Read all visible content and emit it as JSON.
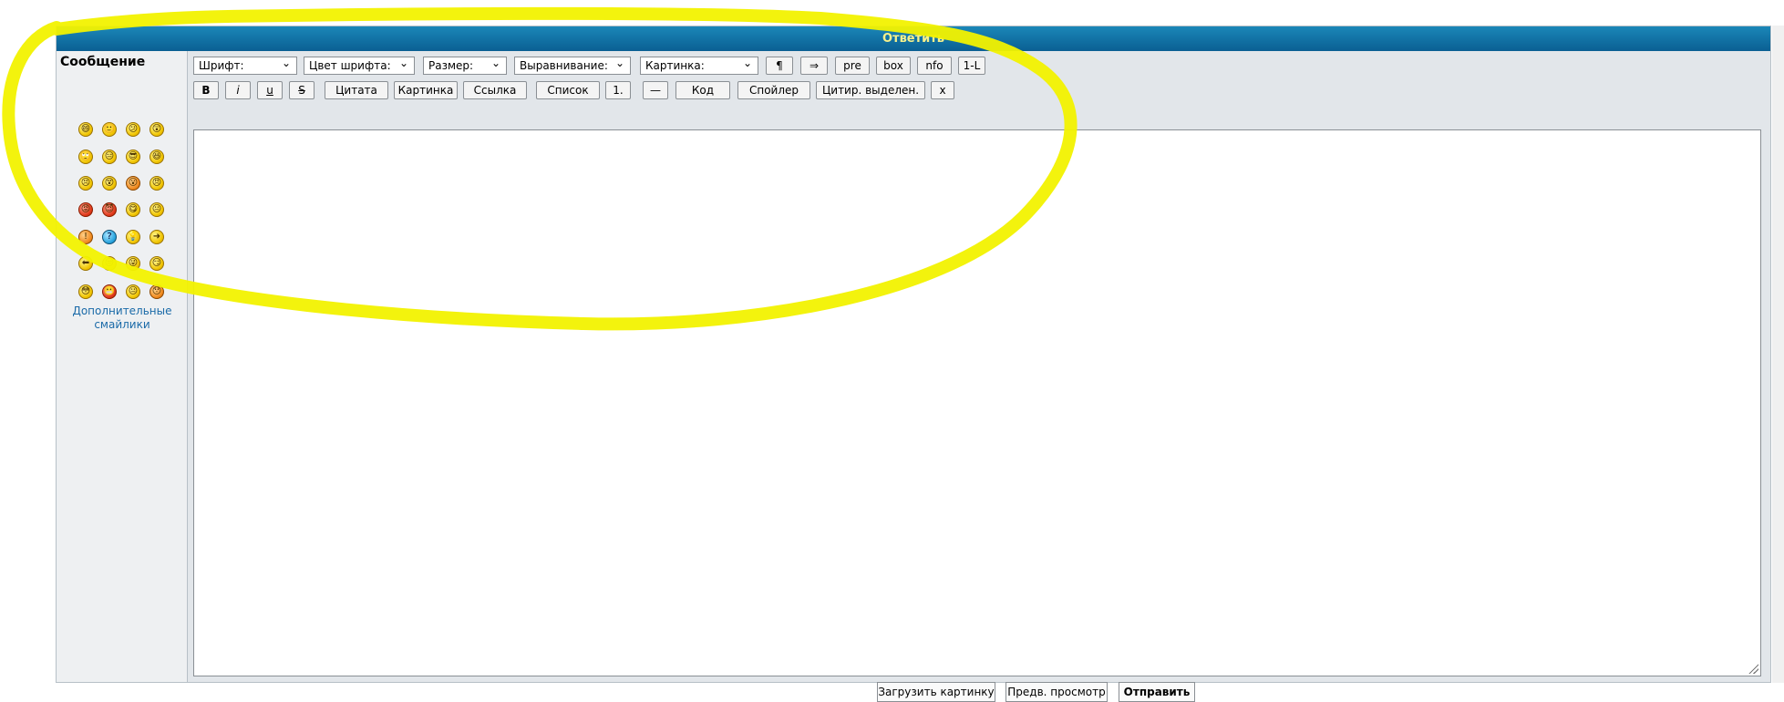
{
  "header": {
    "title": "Ответить"
  },
  "sidebar": {
    "title": "Сообщение",
    "more_smilies": "Дополнительные смайлики",
    "smilies": [
      [
        "😄",
        "🙂",
        "😕",
        "😲"
      ],
      [
        "🙄",
        "😑",
        "😎",
        "😆"
      ],
      [
        "😣",
        "😵",
        "😮",
        "😠"
      ],
      [
        "😡",
        "😈",
        "😋",
        "😐"
      ],
      [
        "!",
        "?",
        "💡",
        "➜"
      ],
      [
        "⬅",
        "😒",
        "😜",
        "😏"
      ],
      [
        "😳",
        "😬",
        "😐",
        "😯"
      ]
    ]
  },
  "toolbar": {
    "font": "Шрифт:",
    "font_color": "Цвет шрифта:",
    "size": "Размер:",
    "align": "Выравнивание:",
    "image": "Картинка:",
    "pilcrow": "¶",
    "arrow": "⇒",
    "pre": "pre",
    "box": "box",
    "nfo": "nfo",
    "ltr": "1-L",
    "bold": "B",
    "italic": "i",
    "underline": "u",
    "strike": "S",
    "quote": "Цитата",
    "picture": "Картинка",
    "link": "Ссылка",
    "list": "Список",
    "numbered": "1.",
    "hr": "—",
    "code": "Код",
    "spoiler": "Спойлер",
    "quote_selected": "Цитир. выделен.",
    "close": "x"
  },
  "editor": {
    "value": ""
  },
  "footer": {
    "upload": "Загрузить картинку",
    "preview": "Предв. просмотр",
    "submit": "Отправить"
  },
  "colors": {
    "header": "#0a6fa6",
    "header_text": "#f7f08a",
    "highlight": "#f2f200"
  }
}
